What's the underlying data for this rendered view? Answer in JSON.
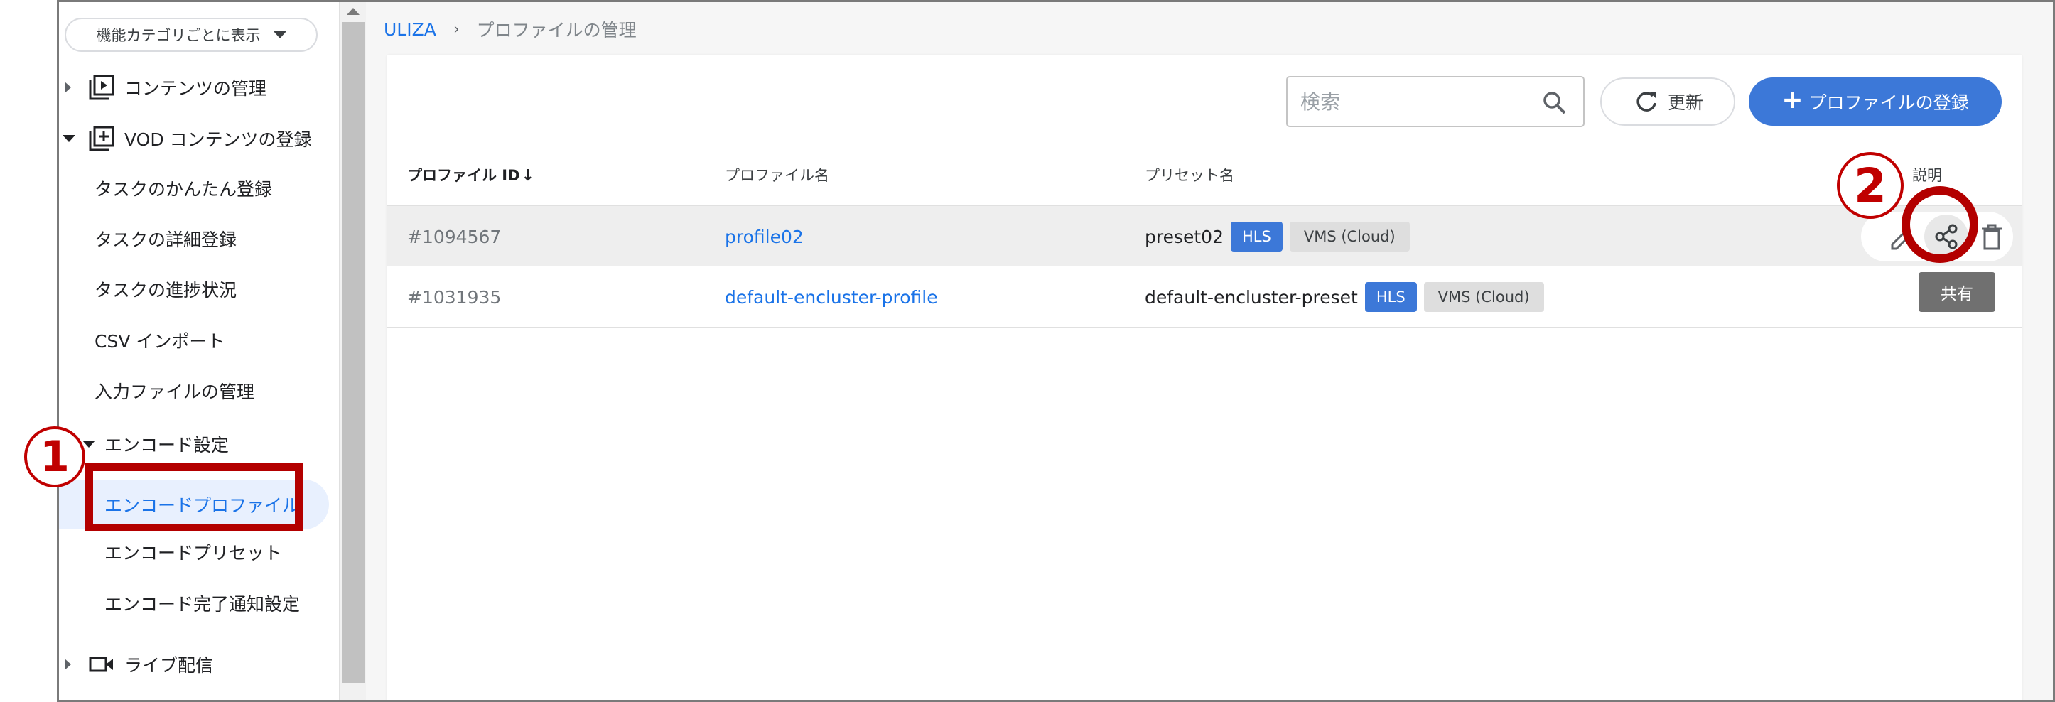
{
  "sidebar": {
    "category_select": "機能カテゴリごとに表示",
    "sections": [
      {
        "label": "コンテンツの管理",
        "icon": "play-box-icon",
        "expanded": false
      },
      {
        "label": "VOD コンテンツの登録",
        "icon": "add-box-icon",
        "expanded": true
      },
      {
        "label": "ライブ配信",
        "icon": "video-camera-icon",
        "expanded": false
      }
    ],
    "vod_items": [
      "タスクのかんたん登録",
      "タスクの詳細登録",
      "タスクの進捗状況",
      "CSV インポート",
      "入力ファイルの管理"
    ],
    "encode_settings": {
      "label": "エンコード設定",
      "items": [
        "エンコードプロファイル",
        "エンコードプリセット",
        "エンコード完了通知設定"
      ],
      "active_index": 0
    }
  },
  "breadcrumb": {
    "home": "ULIZA",
    "separator": "›",
    "current": "プロファイルの管理"
  },
  "toolbar": {
    "search_placeholder": "検索",
    "refresh_label": "更新",
    "add_label": "プロファイルの登録"
  },
  "table": {
    "columns": [
      "プロファイル ID",
      "プロファイル名",
      "プリセット名",
      "説明"
    ],
    "sort_indicator": "↓",
    "rows": [
      {
        "id": "#1094567",
        "name": "profile02",
        "preset": "preset02",
        "tags": [
          "HLS",
          "VMS (Cloud)"
        ]
      },
      {
        "id": "#1031935",
        "name": "default-encluster-profile",
        "preset": "default-encluster-preset",
        "tags": [
          "HLS",
          "VMS (Cloud)"
        ]
      }
    ]
  },
  "tooltip": "共有",
  "annotations": {
    "step1": "1",
    "step2": "2"
  },
  "colors": {
    "accent": "#1a73e8",
    "primary_button": "#3c78d8",
    "annotation": "#c00000",
    "active_bg": "#e8f0fe"
  }
}
